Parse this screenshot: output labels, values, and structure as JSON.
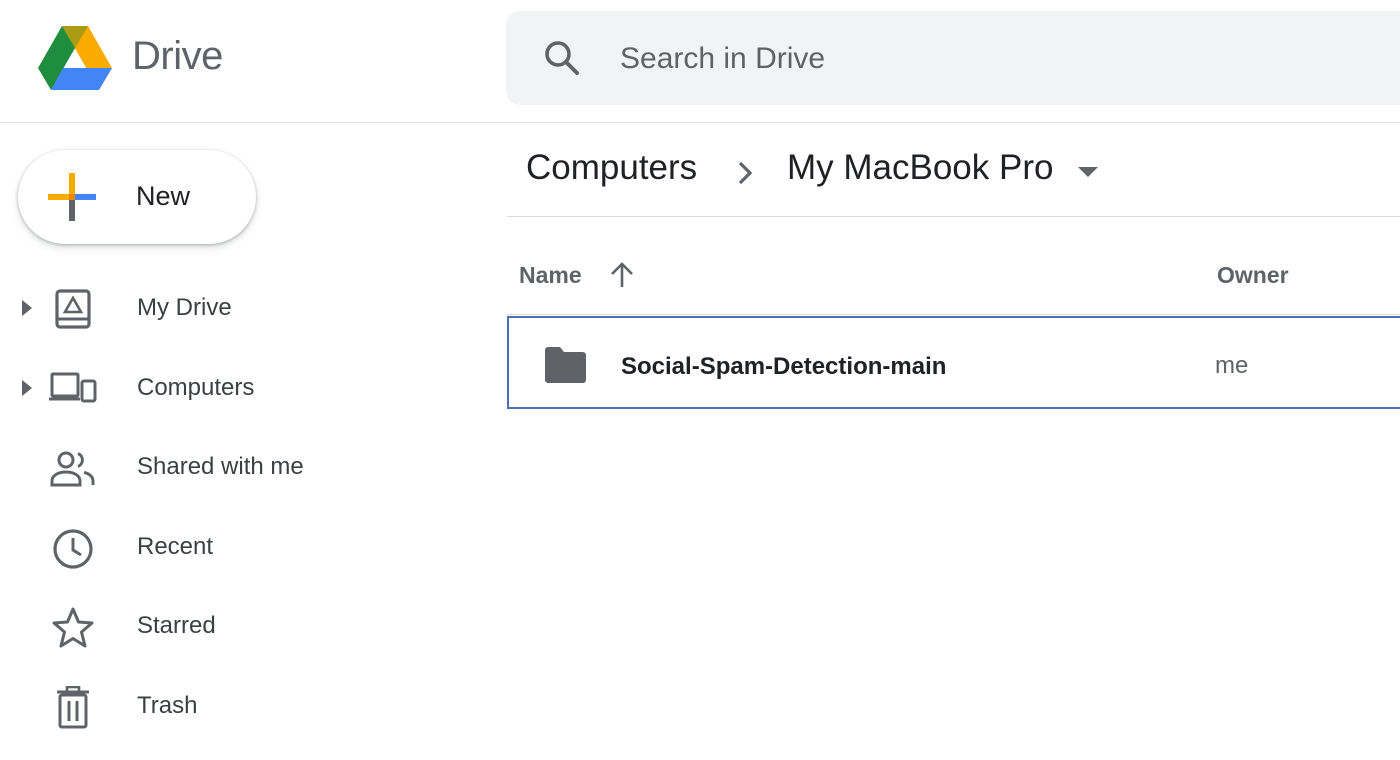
{
  "header": {
    "app_title": "Drive",
    "logo_icon": "google-drive-logo",
    "search": {
      "placeholder": "Search in Drive",
      "icon": "search-icon"
    }
  },
  "new_button": {
    "label": "New",
    "icon": "colored-plus-icon"
  },
  "sidebar": {
    "items": [
      {
        "label": "My Drive",
        "icon": "my-drive-icon",
        "expandable": true
      },
      {
        "label": "Computers",
        "icon": "computers-icon",
        "expandable": true
      },
      {
        "label": "Shared with me",
        "icon": "people-icon",
        "expandable": false
      },
      {
        "label": "Recent",
        "icon": "clock-icon",
        "expandable": false
      },
      {
        "label": "Starred",
        "icon": "star-icon",
        "expandable": false
      },
      {
        "label": "Trash",
        "icon": "trash-icon",
        "expandable": false
      }
    ]
  },
  "breadcrumb": {
    "items": [
      "Computers",
      "My MacBook Pro"
    ],
    "separator_icon": "chevron-right-icon",
    "dropdown_icon": "caret-down-icon"
  },
  "file_list": {
    "columns": {
      "name": "Name",
      "owner": "Owner"
    },
    "sort": {
      "column": "Name",
      "direction": "ascending",
      "icon": "arrow-up-icon"
    },
    "rows": [
      {
        "name": "Social-Spam-Detection-main",
        "owner": "me",
        "type_icon": "folder-icon",
        "selected": true
      }
    ]
  },
  "colors": {
    "text_primary": "#202124",
    "text_secondary": "#5f6368",
    "search_bg": "#f1f3f4",
    "divider": "#dadce0",
    "selection_border": "#4a6fb5",
    "logo_green": "#1e8e3e",
    "logo_yellow": "#f9ab00",
    "logo_blue": "#4285f4"
  }
}
